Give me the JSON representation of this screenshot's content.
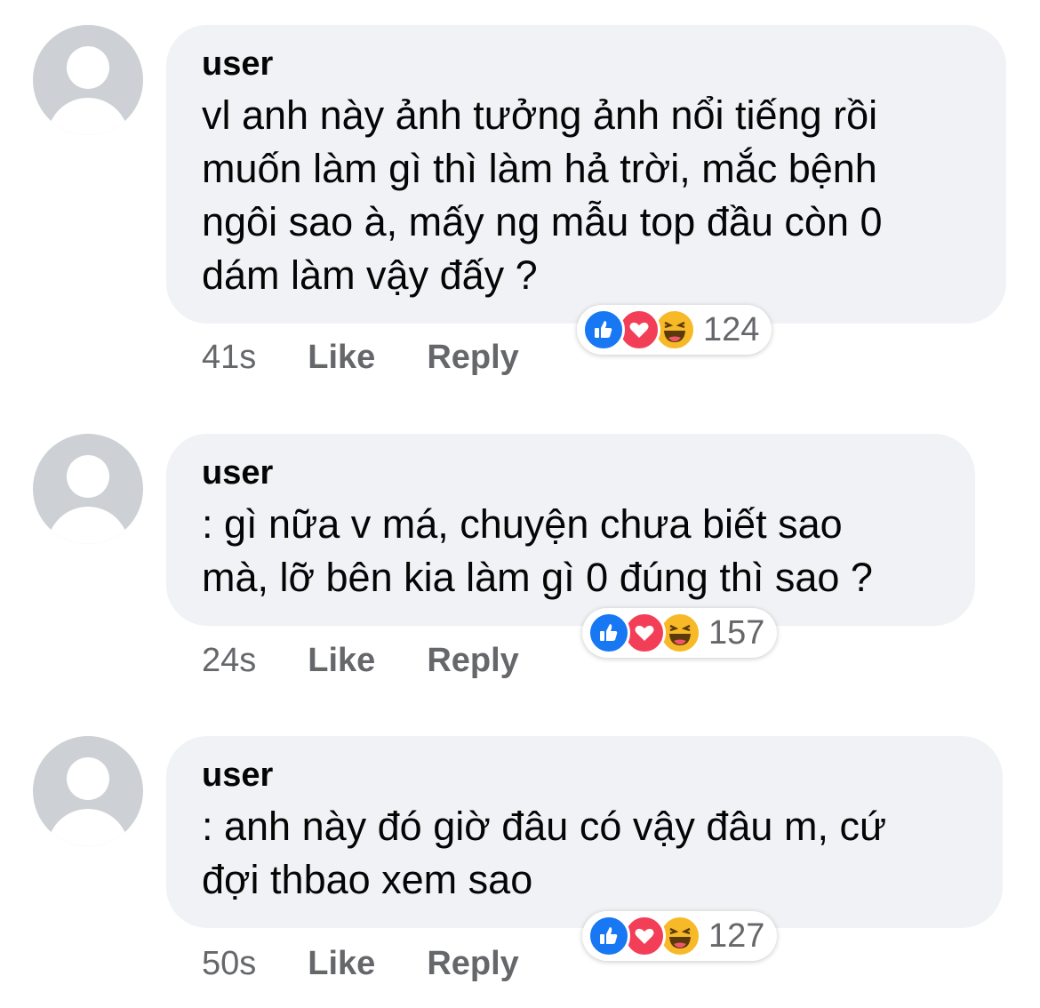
{
  "comments": [
    {
      "author": "user",
      "text": "vl anh này ảnh tưởng ảnh nổi tiếng rồi\nmuốn làm gì thì làm hả trời, mắc bệnh\nngôi sao à, mấy ng mẫu top đầu còn 0\ndám làm vậy đấy ?",
      "time": "41s",
      "like_label": "Like",
      "reply_label": "Reply",
      "reaction_count": "124",
      "reactions": [
        "like-icon",
        "love-icon",
        "haha-icon"
      ]
    },
    {
      "author": "user",
      "text": ": gì nữa v má, chuyện chưa biết sao\nmà, lỡ bên kia làm gì 0 đúng thì sao ?",
      "time": "24s",
      "like_label": "Like",
      "reply_label": "Reply",
      "reaction_count": "157",
      "reactions": [
        "like-icon",
        "love-icon",
        "haha-icon"
      ]
    },
    {
      "author": "user",
      "text": ": anh này đó giờ đâu có vậy đâu m, cứ\nđợi thbao xem sao",
      "time": "50s",
      "like_label": "Like",
      "reply_label": "Reply",
      "reaction_count": "127",
      "reactions": [
        "like-icon",
        "love-icon",
        "haha-icon"
      ]
    }
  ],
  "colors": {
    "bubble": "#f0f2f5",
    "like": "#1877f2",
    "love": "#f33e58",
    "haha": "#f7b928",
    "meta_text": "#65676b"
  }
}
